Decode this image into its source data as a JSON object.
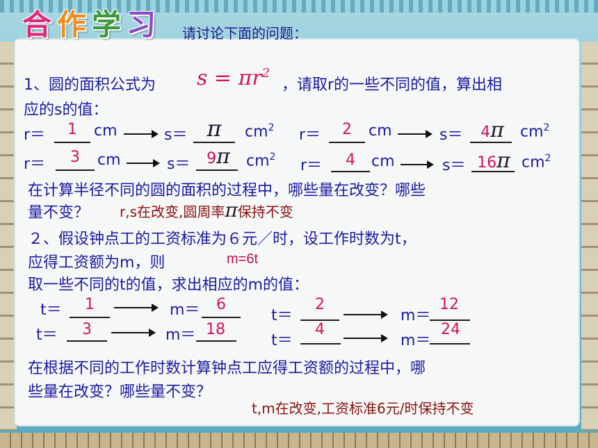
{
  "header": {
    "logo_chars": [
      "合",
      "作",
      "学",
      "习"
    ],
    "logo_colors": [
      "#e0287a",
      "#f28c1a",
      "#3c9a3c",
      "#8a4cc4"
    ],
    "prompt": "请讨论下面的问题："
  },
  "q1": {
    "intro_pre": "1、圆的面积公式为",
    "formula": "s = πr",
    "formula_exp": "2",
    "intro_post": "，请取r的一些不同的值，算出相",
    "intro_line2": "应的s的值：",
    "r_prefix": "r＝",
    "cm": "cm",
    "s_prefix": "s＝",
    "cm2": "cm",
    "sup": "2",
    "pi": "π",
    "pairs": [
      {
        "r": "1",
        "s": ""
      },
      {
        "r": "2",
        "s": "4"
      },
      {
        "r": "3",
        "s": "9"
      },
      {
        "r": "4",
        "s": "16"
      }
    ],
    "question": "在计算半径不同的圆的面积的过程中，哪些量在改变？哪些",
    "question2": "量不变？",
    "answer_pre": "r,s在改变,圆周率",
    "answer_post": "保持不变"
  },
  "q2": {
    "intro": "２、假设钟点工的工资标准为６元／时，设工作时数为t，",
    "intro2": "应得工资额为m，则",
    "formula": "m=6t",
    "intro3": "取一些不同的t的值，求出相应的m的值：",
    "t_prefix": "t＝",
    "m_prefix": "m＝",
    "pairs": [
      {
        "t": "1",
        "m": "6"
      },
      {
        "t": "2",
        "m": "12"
      },
      {
        "t": "3",
        "m": "18"
      },
      {
        "t": "4",
        "m": "24"
      }
    ],
    "question": "在根据不同的工作时数计算钟点工应得工资额的过程中，哪",
    "question2": "些量在改变？哪些量不变？",
    "answer": "t,m在改变,工资标准6元/时保持不变"
  }
}
